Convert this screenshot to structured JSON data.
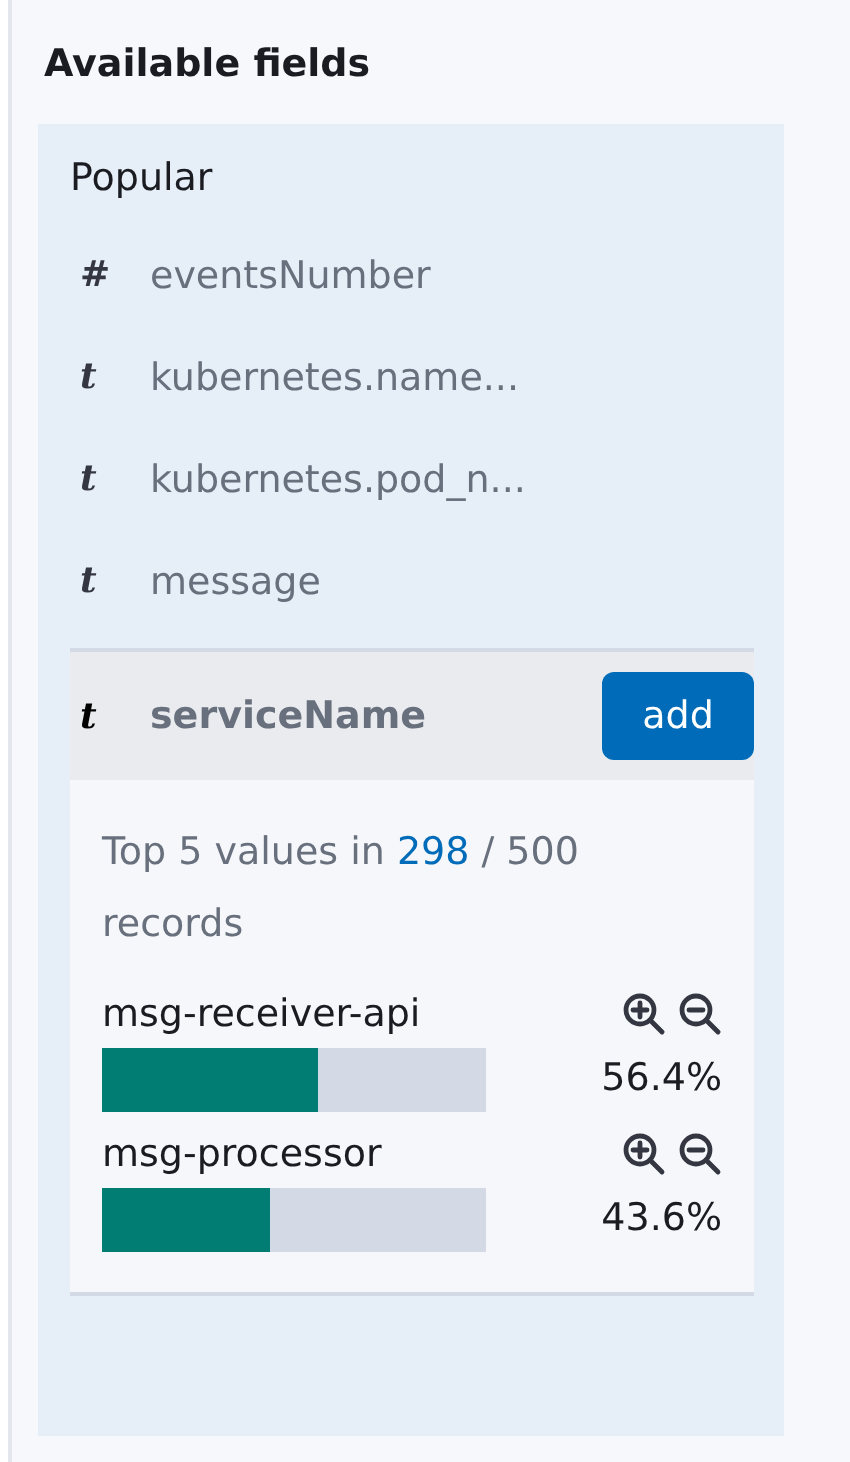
{
  "title": "Available fields",
  "section": "Popular",
  "fields": [
    {
      "type": "#",
      "name": "eventsNumber",
      "selected": false
    },
    {
      "type": "t",
      "name": "kubernetes.name...",
      "selected": false
    },
    {
      "type": "t",
      "name": "kubernetes.pod_n...",
      "selected": false
    },
    {
      "type": "t",
      "name": "message",
      "selected": false
    },
    {
      "type": "t",
      "name": "serviceName",
      "selected": true,
      "action": "add",
      "details": {
        "summary_before": "Top 5 values in",
        "summary_link": "298",
        "summary_after": "/ 500 records",
        "values": [
          {
            "name": "msg-receiver-api",
            "level": 0.564,
            "percent": "56.4%"
          },
          {
            "name": "msg-processor",
            "level": 0.436,
            "percent": "43.6%"
          }
        ]
      }
    }
  ]
}
